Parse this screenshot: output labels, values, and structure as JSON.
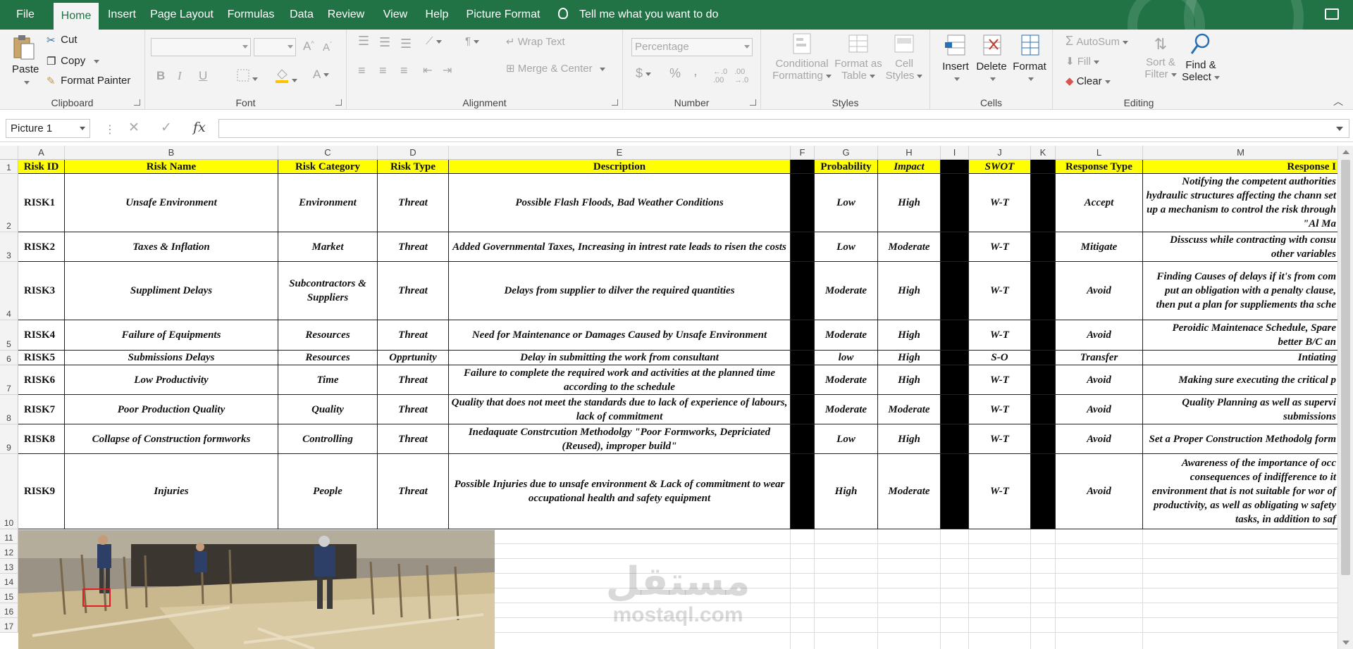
{
  "tabs": [
    "File",
    "Home",
    "Insert",
    "Page Layout",
    "Formulas",
    "Data",
    "Review",
    "View",
    "Help",
    "Picture Format"
  ],
  "active_tab": "Home",
  "tell_me": "Tell me what you want to do",
  "ribbon": {
    "clipboard": {
      "paste": "Paste",
      "cut": "Cut",
      "copy": "Copy",
      "format_painter": "Format Painter",
      "label": "Clipboard"
    },
    "font": {
      "label": "Font",
      "bold": "B",
      "italic": "I",
      "underline": "U"
    },
    "alignment": {
      "wrap_text": "Wrap Text",
      "merge_center": "Merge & Center",
      "label": "Alignment"
    },
    "number": {
      "format": "Percentage",
      "currency": "$",
      "percent": "%",
      "comma": ",",
      "label": "Number"
    },
    "styles": {
      "conditional_1": "Conditional",
      "conditional_2": "Formatting",
      "format_table_1": "Format as",
      "format_table_2": "Table",
      "cell_styles_1": "Cell",
      "cell_styles_2": "Styles",
      "label": "Styles"
    },
    "cells": {
      "insert": "Insert",
      "delete": "Delete",
      "format": "Format",
      "label": "Cells"
    },
    "editing": {
      "autosum": "AutoSum",
      "fill": "Fill",
      "clear": "Clear",
      "sort_1": "Sort &",
      "sort_2": "Filter",
      "find_1": "Find &",
      "find_2": "Select",
      "label": "Editing"
    }
  },
  "formula_bar": {
    "name_box": "Picture 1",
    "fx": "fx",
    "value": ""
  },
  "columns": [
    "A",
    "B",
    "C",
    "D",
    "E",
    "F",
    "G",
    "H",
    "I",
    "J",
    "K",
    "L",
    "M"
  ],
  "rows": [
    "1",
    "2",
    "3",
    "4",
    "5",
    "6",
    "7",
    "8",
    "9",
    "10",
    "11",
    "12",
    "13",
    "14",
    "15",
    "16",
    "17"
  ],
  "table": {
    "headers": {
      "risk_id": "Risk ID",
      "risk_name": "Risk Name",
      "risk_category": "Risk Category",
      "risk_type": "Risk Type",
      "description": "Description",
      "probability": "Probability",
      "impact": "Impact",
      "swot": "SWOT",
      "response_type": "Response Type",
      "response": "Response I"
    },
    "rows": [
      {
        "id": "RISK1",
        "name": "Unsafe Environment",
        "category": "Environment",
        "type": "Threat",
        "description": "Possible Flash Floods, Bad Weather Conditions",
        "probability": "Low",
        "impact": "High",
        "swot": "W-T",
        "response_type": "Accept",
        "response": "Notifying the competent authorities hydraulic structures affecting the chann set up a mechanism to  control the risk through \"Al Ma"
      },
      {
        "id": "RISK2",
        "name": "Taxes & Inflation",
        "category": "Market",
        "type": "Threat",
        "description": "Added Governmental Taxes, Increasing in intrest rate leads to risen the costs",
        "probability": "Low",
        "impact": "Moderate",
        "swot": "W-T",
        "response_type": "Mitigate",
        "response": "Disscuss while contracting with consu other variables"
      },
      {
        "id": "RISK3",
        "name": "Suppliment Delays",
        "category": "Subcontractors & Suppliers",
        "type": "Threat",
        "description": "Delays from supplier to dilver the required quantities",
        "probability": "Moderate",
        "impact": "High",
        "swot": "W-T",
        "response_type": "Avoid",
        "response": "Finding Causes of delays if it's from com put an obligation with a penalty clause, then put a plan for supplieme​nts tha sche"
      },
      {
        "id": "RISK4",
        "name": "Failure of Equipments",
        "category": "Resources",
        "type": "Threat",
        "description": "Need for Maintenance or Damages Caused by Unsafe Environment",
        "probability": "Moderate",
        "impact": "High",
        "swot": "W-T",
        "response_type": "Avoid",
        "response": "Peroidic Maintenace Schedule, Spare better B/C an"
      },
      {
        "id": "RISK5",
        "name": "Submissions Delays",
        "category": "Resources",
        "type": "Opprtunity",
        "description": "Delay in submitting the work from consultant",
        "probability": "low",
        "impact": "High",
        "swot": "S-O",
        "response_type": "Transfer",
        "response": "Intiating"
      },
      {
        "id": "RISK6",
        "name": "Low Productivity",
        "category": "Time",
        "type": "Threat",
        "description": "Failure to complete the required work and activities at the planned time according to the schedule",
        "probability": "Moderate",
        "impact": "High",
        "swot": "W-T",
        "response_type": "Avoid",
        "response": "Making sure executing the critical p"
      },
      {
        "id": "RISK7",
        "name": "Poor Production Quality",
        "category": "Quality",
        "type": "Threat",
        "description": "Quality that does not meet the standards due to lack of experience of labours, lack of commitment",
        "probability": "Moderate",
        "impact": "Moderate",
        "swot": "W-T",
        "response_type": "Avoid",
        "response": "Quality Planning as well as supervi submissions"
      },
      {
        "id": "RISK8",
        "name": "Collapse of Construction formworks",
        "category": "Controlling",
        "type": "Threat",
        "description": "Inedaquate Constrcution Methodolgy \"Poor Formworks, Depriciated (Reused), improper build\"",
        "probability": "Low",
        "impact": "High",
        "swot": "W-T",
        "response_type": "Avoid",
        "response": "Set a Proper Construction Methodolg form"
      },
      {
        "id": "RISK9",
        "name": "Injuries",
        "category": "People",
        "type": "Threat",
        "description": "Possible Injuries due to unsafe environment & Lack of commitment to wear occupational health and safety equipment",
        "probability": "High",
        "impact": "Moderate",
        "swot": "W-T",
        "response_type": "Avoid",
        "response": "Awareness of the importance of occ consequences of indifference to it environment that is not suitable for wor of productivity, as well as obligating w safety tasks, in addition to saf"
      }
    ]
  },
  "watermark": {
    "arabic": "مستقل",
    "latin": "mostaql.com"
  },
  "colors": {
    "ribbon_green": "#217346",
    "header_yellow": "#ffff00",
    "separator_black": "#000000"
  }
}
